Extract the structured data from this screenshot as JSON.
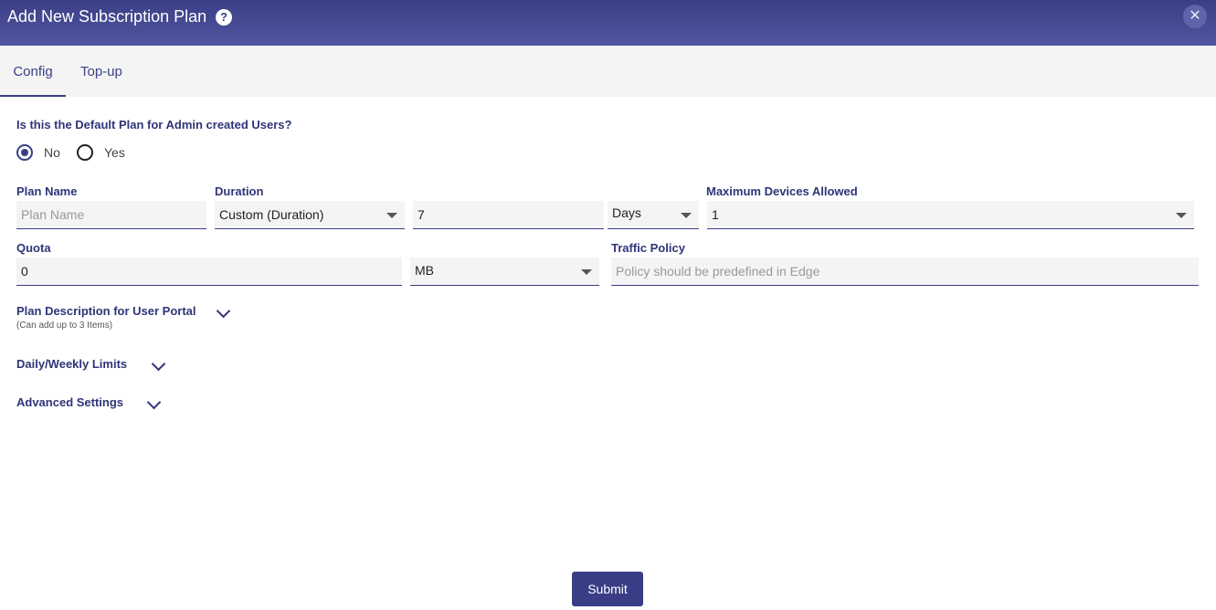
{
  "dialog": {
    "title": "Add New Subscription Plan",
    "help_glyph": "?",
    "close_glyph": "✕"
  },
  "tabs": [
    {
      "label": "Config",
      "active": true
    },
    {
      "label": "Top-up",
      "active": false
    }
  ],
  "default_plan": {
    "question": "Is this the Default Plan for Admin created Users?",
    "options": [
      {
        "label": "No",
        "selected": true
      },
      {
        "label": "Yes",
        "selected": false
      }
    ]
  },
  "fields": {
    "plan_name": {
      "label": "Plan Name",
      "value": "",
      "placeholder": "Plan Name"
    },
    "duration": {
      "label": "Duration",
      "type_value": "Custom (Duration)",
      "amount": "7",
      "unit": "Days"
    },
    "max_devices": {
      "label": "Maximum Devices Allowed",
      "value": "1"
    },
    "quota": {
      "label": "Quota",
      "value": "0",
      "unit": "MB"
    },
    "traffic_policy": {
      "label": "Traffic Policy",
      "value": "",
      "placeholder": "Policy should be predefined in Edge"
    }
  },
  "sections": {
    "plan_description": {
      "label": "Plan Description for User Portal",
      "hint": "(Can add up to 3 Items)"
    },
    "limits": {
      "label": "Daily/Weekly Limits"
    },
    "advanced": {
      "label": "Advanced Settings"
    }
  },
  "actions": {
    "submit_label": "Submit"
  },
  "colors": {
    "accent": "#3a3f86",
    "header_start": "#3b3f86",
    "header_end": "#4f55a0"
  }
}
